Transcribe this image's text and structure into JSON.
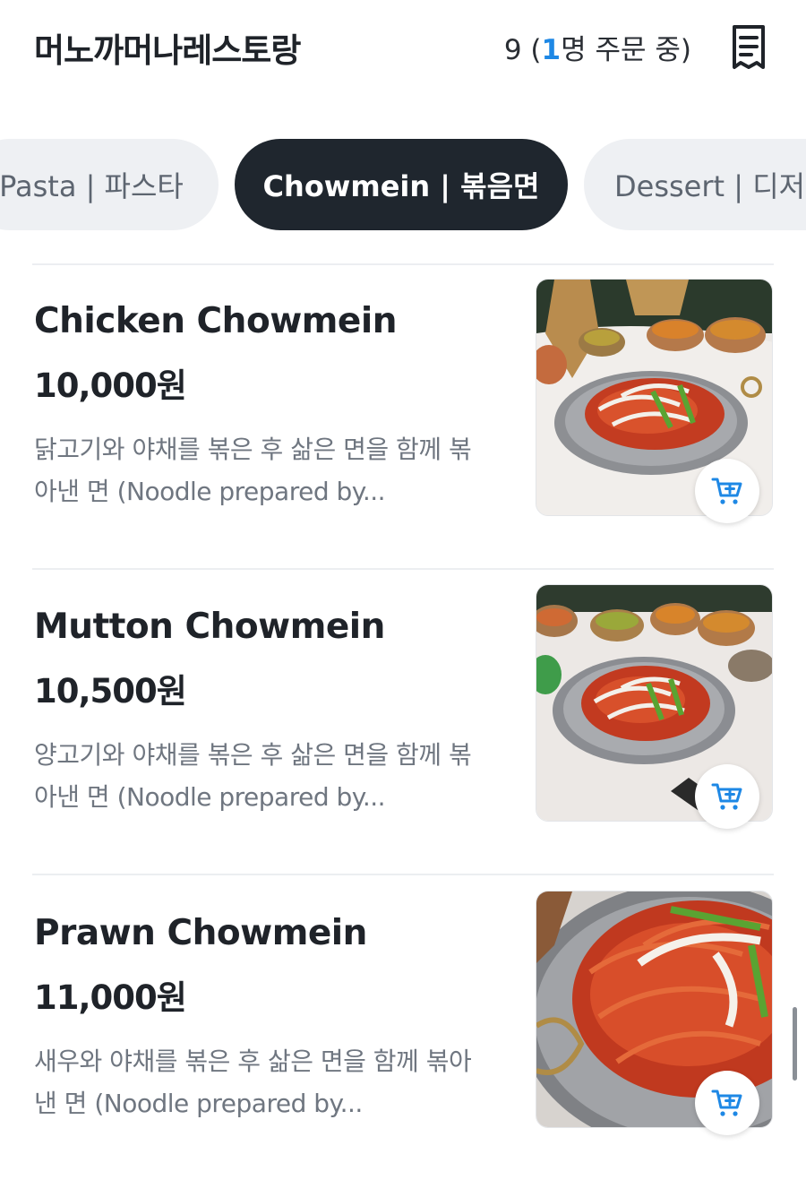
{
  "header": {
    "store_name": "머노까머나레스토랑",
    "table_number": "9",
    "order_prefix": " (",
    "order_count": "1",
    "order_suffix": "명 주문 중)",
    "receipt_icon": "receipt-icon"
  },
  "tabs": [
    {
      "label": "Pasta | 파스타",
      "active": false
    },
    {
      "label": "Chowmein | 볶음면",
      "active": true
    },
    {
      "label": "Dessert | 디저트",
      "active": false
    }
  ],
  "colors": {
    "accent": "#1e88e5",
    "active_tab_bg": "#1f262e",
    "tab_bg": "#eef0f3"
  },
  "menu_items": [
    {
      "name": "Chicken Chowmein",
      "price": "10,000원",
      "description": "닭고기와 야채를 볶은 후 삶은 면을 함께 볶아낸 면 (Noodle prepared by...",
      "cart_icon": "add-to-cart-icon"
    },
    {
      "name": "Mutton Chowmein",
      "price": "10,500원",
      "description": "양고기와 야채를 볶은 후 삶은 면을 함께 볶아낸 면 (Noodle prepared by...",
      "cart_icon": "add-to-cart-icon"
    },
    {
      "name": "Prawn Chowmein",
      "price": "11,000원",
      "description": "새우와 야채를 볶은 후 삶은 면을 함께 볶아낸 면 (Noodle prepared by...",
      "cart_icon": "add-to-cart-icon"
    }
  ]
}
